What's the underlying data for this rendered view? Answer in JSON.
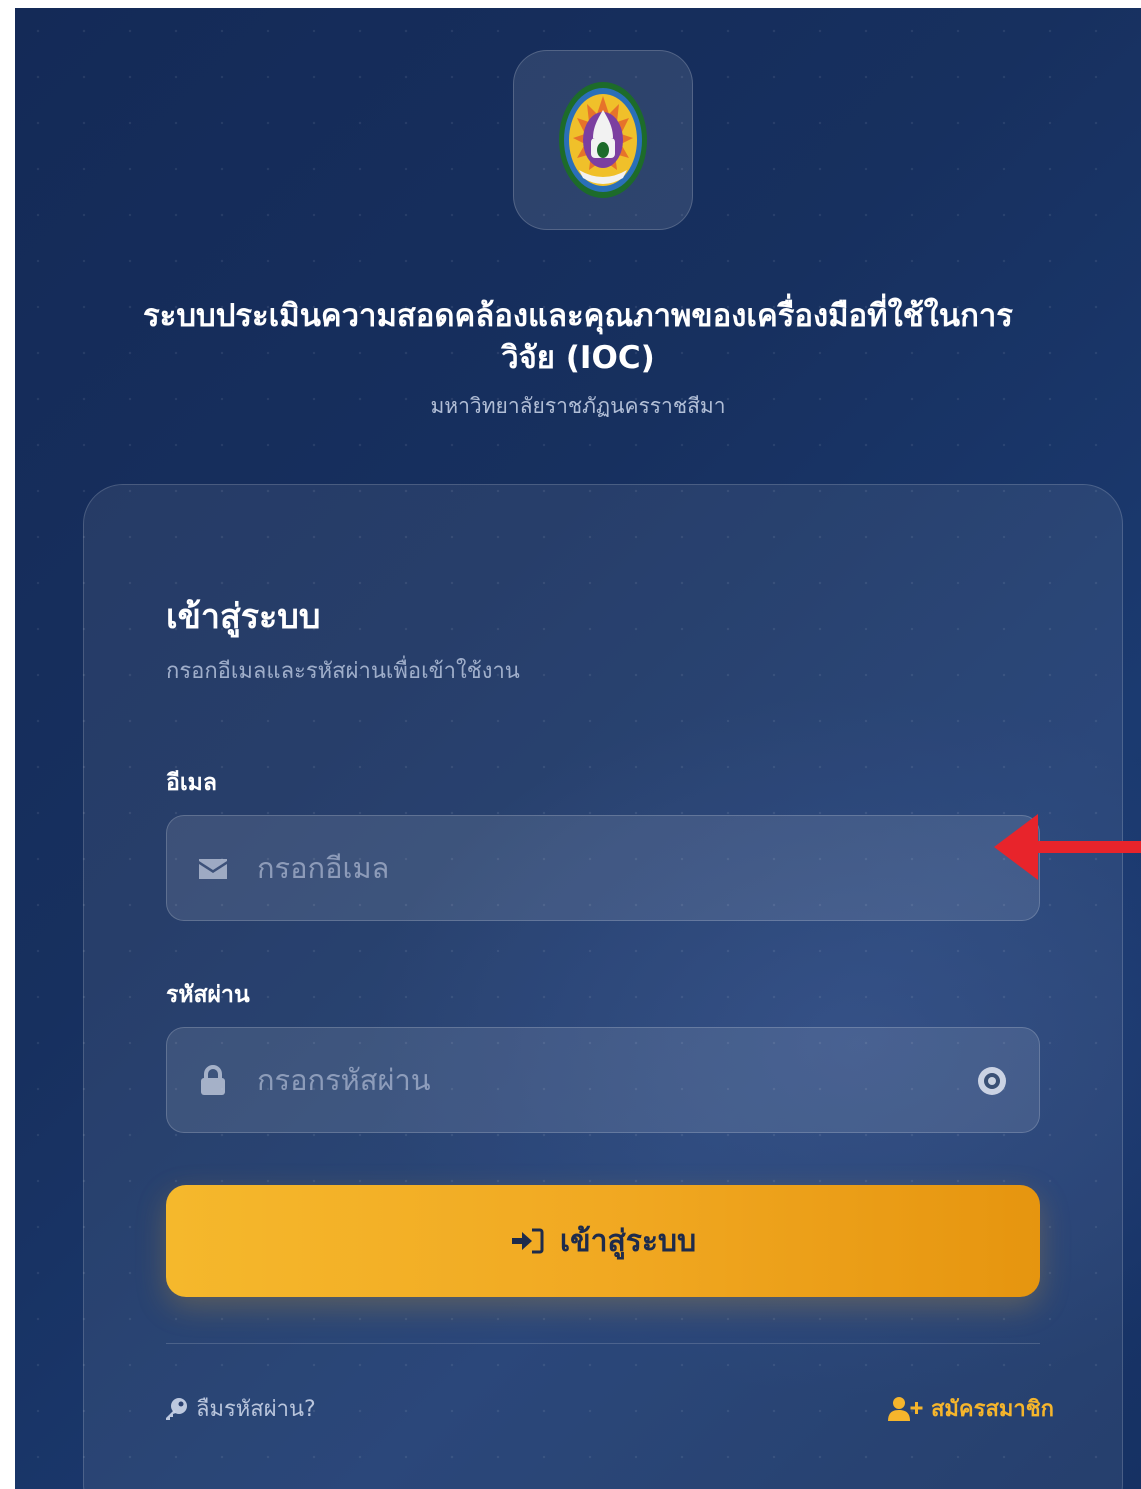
{
  "header": {
    "title_line1": "ระบบประเมินความสอดคล้องและคุณภาพของเครื่องมือที่ใช้ในการ",
    "title_line2": "วิจัย (IOC)",
    "subtitle": "มหาวิทยาลัยราชภัฏนครราชสีมา",
    "logo_icon": "university-seal-icon"
  },
  "login_card": {
    "title": "เข้าสู่ระบบ",
    "subtitle": "กรอกอีเมลและรหัสผ่านเพื่อเข้าใช้งาน",
    "email": {
      "label": "อีเมล",
      "placeholder": "กรอกอีเมล",
      "value": "",
      "icon": "envelope-icon"
    },
    "password": {
      "label": "รหัสผ่าน",
      "placeholder": "กรอกรหัสผ่าน",
      "value": "",
      "icon": "lock-icon",
      "toggle_icon": "eye-icon"
    },
    "submit": {
      "label": "เข้าสู่ระบบ",
      "icon": "sign-in-icon"
    },
    "forgot_password": {
      "label": "ลืมรหัสผ่าน?",
      "icon": "key-icon"
    },
    "register": {
      "label": "สมัครสมาชิก",
      "icon": "user-plus-icon"
    }
  },
  "colors": {
    "background": "#17305f",
    "accent": "#f1a922",
    "accent_text": "#f5b52c",
    "button_text": "#1d2b4c",
    "annotation_arrow": "#e8242b"
  }
}
